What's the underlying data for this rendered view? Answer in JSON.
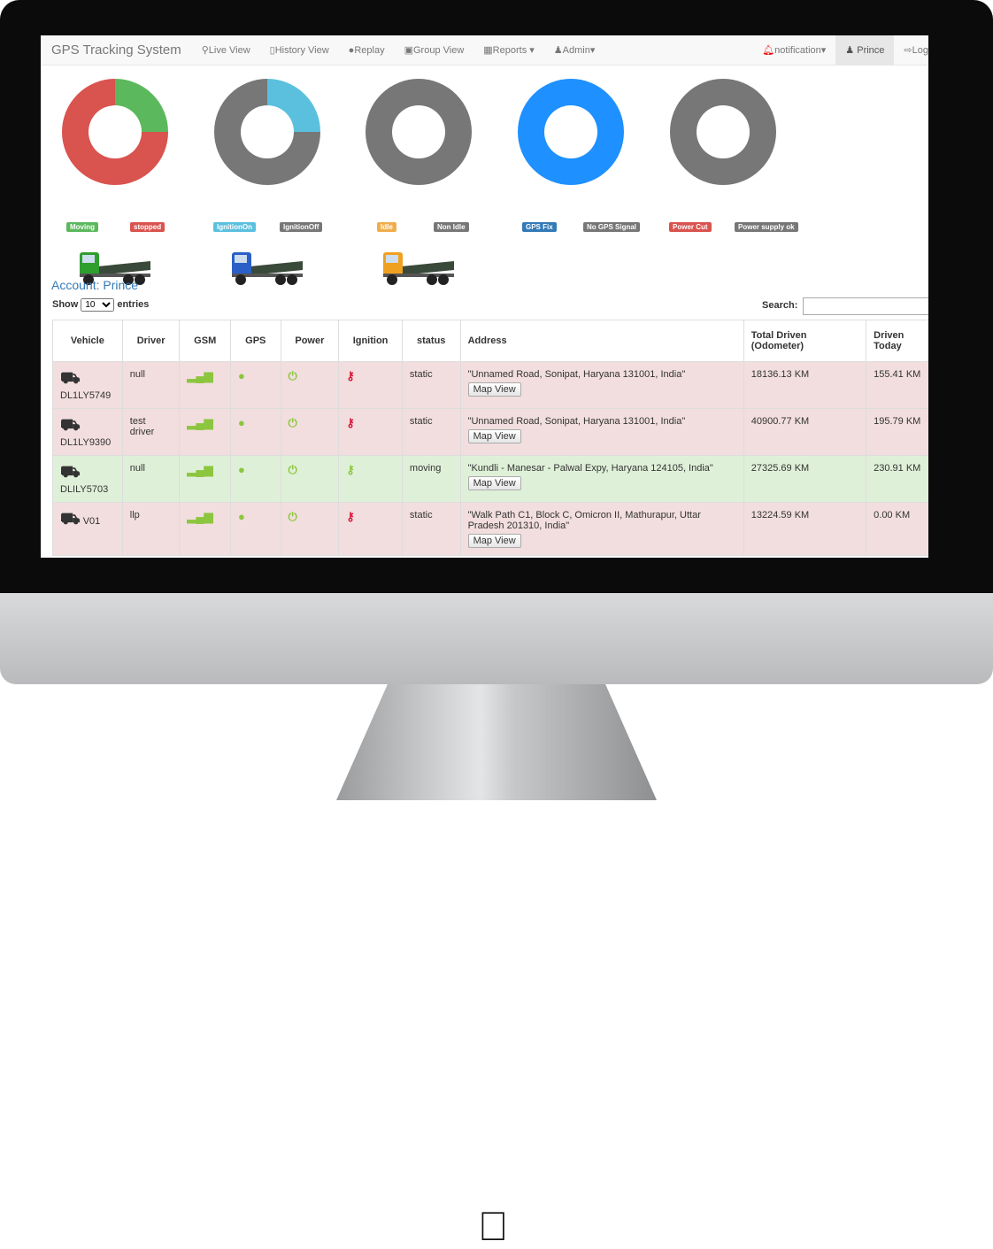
{
  "nav": {
    "brand": "GPS Tracking System",
    "items": [
      "Live View",
      "History View",
      "Replay",
      "Group View",
      "Reports",
      "Admin"
    ],
    "notification": "notification",
    "user": "Prince",
    "logout": "Log"
  },
  "charts": [
    {
      "labels": [
        "Moving",
        "stopped"
      ],
      "values": [
        25,
        75
      ],
      "colors": [
        "#5cb85c",
        "#d9534f"
      ]
    },
    {
      "labels": [
        "IgnitionOn",
        "IgnitionOff"
      ],
      "values": [
        25,
        75
      ],
      "colors": [
        "#5bc0de",
        "#777777"
      ]
    },
    {
      "labels": [
        "Idle",
        "Non Idle"
      ],
      "values": [
        0,
        100
      ],
      "colors": [
        "#f0ad4e",
        "#777777"
      ]
    },
    {
      "labels": [
        "GPS Fix",
        "No GPS Signal"
      ],
      "values": [
        100,
        0
      ],
      "colors": [
        "#1e90ff",
        "#777777"
      ]
    },
    {
      "labels": [
        "Power Cut",
        "Power supply ok"
      ],
      "values": [
        0,
        100
      ],
      "colors": [
        "#d9534f",
        "#777777"
      ]
    }
  ],
  "trucks": [
    "#2e9e2e",
    "#2a5fc8",
    "#f0a020"
  ],
  "account": "Account: Prince",
  "table_controls": {
    "show": "Show",
    "entries_value": "10",
    "entries": "entries",
    "search": "Search:"
  },
  "columns": [
    "Vehicle",
    "Driver",
    "GSM",
    "GPS",
    "Power",
    "Ignition",
    "status",
    "Address",
    "Total Driven (Odometer)",
    "Driven Today"
  ],
  "map_view": "Map View",
  "rows": [
    {
      "vehicle": "DL1LY5749",
      "driver": "null",
      "ignition": "off",
      "status": "static",
      "address": "\"Unnamed Road, Sonipat, Haryana 131001, India\"",
      "total": "18136.13 KM",
      "today": "155.41 KM",
      "row": "red"
    },
    {
      "vehicle": "DL1LY9390",
      "driver": "test driver",
      "ignition": "off",
      "status": "static",
      "address": "\"Unnamed Road, Sonipat, Haryana 131001, India\"",
      "total": "40900.77 KM",
      "today": "195.79 KM",
      "row": "red"
    },
    {
      "vehicle": "DLILY5703",
      "driver": "null",
      "ignition": "on",
      "status": "moving",
      "address": "\"Kundli - Manesar - Palwal Expy, Haryana 124105, India\"",
      "total": "27325.69 KM",
      "today": "230.91 KM",
      "row": "green"
    },
    {
      "vehicle": "V01",
      "driver": "llp",
      "ignition": "off",
      "status": "static",
      "address": "\"Walk Path C1, Block C, Omicron II, Mathurapur, Uttar Pradesh 201310, India\"",
      "total": "13224.59 KM",
      "today": "0.00 KM",
      "row": "red"
    }
  ]
}
